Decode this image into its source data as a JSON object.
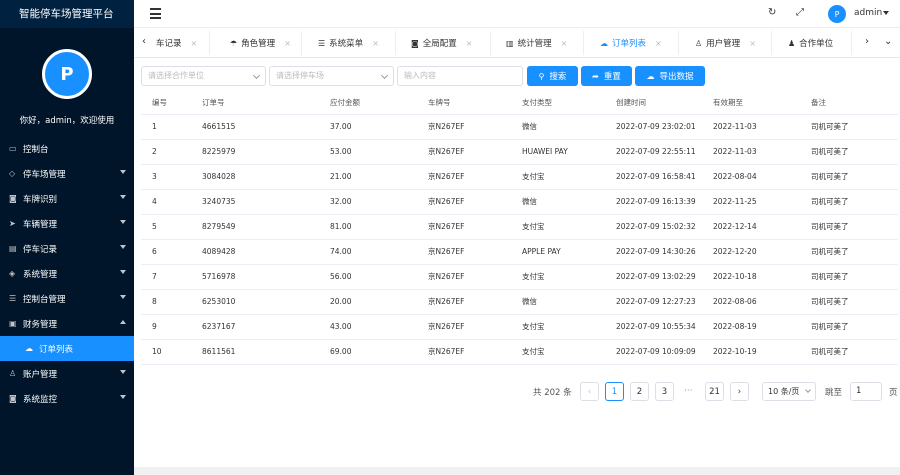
{
  "app": {
    "title": "智能停车场管理平台"
  },
  "user": {
    "welcome": "你好，admin，欢迎使用",
    "name": "admin",
    "avatar_label": "P"
  },
  "sidebar": {
    "items": [
      {
        "label": "控制台",
        "icon": "monitor-icon",
        "glyph": "▭",
        "has_arrow": false
      },
      {
        "label": "停车场管理",
        "icon": "diamond-icon",
        "glyph": "◇",
        "has_arrow": true
      },
      {
        "label": "车牌识别",
        "icon": "camera-icon",
        "glyph": "◙",
        "has_arrow": true
      },
      {
        "label": "车辆管理",
        "icon": "send-icon",
        "glyph": "➤",
        "has_arrow": true
      },
      {
        "label": "停车记录",
        "icon": "document-icon",
        "glyph": "▤",
        "has_arrow": true
      },
      {
        "label": "系统管理",
        "icon": "layers-icon",
        "glyph": "◈",
        "has_arrow": true
      },
      {
        "label": "控制台管理",
        "icon": "list-icon",
        "glyph": "☰",
        "has_arrow": true
      },
      {
        "label": "财务管理",
        "icon": "wallet-icon",
        "glyph": "▣",
        "has_arrow": true,
        "expanded": true
      }
    ],
    "sub_item": {
      "label": "订单列表",
      "icon": "cloud-icon",
      "glyph": "☁"
    },
    "tail_items": [
      {
        "label": "账户管理",
        "icon": "user-icon",
        "glyph": "♙"
      },
      {
        "label": "系统监控",
        "icon": "camera-icon",
        "glyph": "◙"
      }
    ]
  },
  "header": {
    "icons": [
      "menu-icon",
      "refresh-icon",
      "fullscreen-icon"
    ]
  },
  "tabs": [
    {
      "label": "车记录",
      "icon": "",
      "active": false
    },
    {
      "label": "角色管理",
      "icon": "☂",
      "active": false
    },
    {
      "label": "系统菜单",
      "icon": "☰",
      "active": false
    },
    {
      "label": "全局配置",
      "icon": "◙",
      "active": false
    },
    {
      "label": "统计管理",
      "icon": "▥",
      "active": false
    },
    {
      "label": "订单列表",
      "icon": "☁",
      "active": true
    },
    {
      "label": "用户管理",
      "icon": "♙",
      "active": false
    },
    {
      "label": "合作单位",
      "icon": "♟",
      "active": false
    }
  ],
  "filters": {
    "partner_placeholder": "请选择合作单位",
    "lot_placeholder": "请选择停车场",
    "keyword_placeholder": "输入内容",
    "search_label": "搜索",
    "reset_label": "重置",
    "export_label": "导出数据"
  },
  "table": {
    "headers": [
      "编号",
      "订单号",
      "应付金额",
      "车牌号",
      "支付类型",
      "创建时间",
      "有效期至",
      "备注"
    ],
    "rows": [
      [
        "1",
        "4661515",
        "37.00",
        "京N267EF",
        "微信",
        "2022-07-09 23:02:01",
        "2022-11-03",
        "司机可美了"
      ],
      [
        "2",
        "8225979",
        "53.00",
        "京N267EF",
        "HUAWEI PAY",
        "2022-07-09 22:55:11",
        "2022-11-03",
        "司机可美了"
      ],
      [
        "3",
        "3084028",
        "21.00",
        "京N267EF",
        "支付宝",
        "2022-07-09 16:58:41",
        "2022-08-04",
        "司机可美了"
      ],
      [
        "4",
        "3240735",
        "32.00",
        "京N267EF",
        "微信",
        "2022-07-09 16:13:39",
        "2022-11-25",
        "司机可美了"
      ],
      [
        "5",
        "8279549",
        "81.00",
        "京N267EF",
        "支付宝",
        "2022-07-09 15:02:32",
        "2022-12-14",
        "司机可美了"
      ],
      [
        "6",
        "4089428",
        "74.00",
        "京N267EF",
        "APPLE PAY",
        "2022-07-09 14:30:26",
        "2022-12-20",
        "司机可美了"
      ],
      [
        "7",
        "5716978",
        "56.00",
        "京N267EF",
        "支付宝",
        "2022-07-09 13:02:29",
        "2022-10-18",
        "司机可美了"
      ],
      [
        "8",
        "6253010",
        "20.00",
        "京N267EF",
        "微信",
        "2022-07-09 12:27:23",
        "2022-08-06",
        "司机可美了"
      ],
      [
        "9",
        "6237167",
        "43.00",
        "京N267EF",
        "支付宝",
        "2022-07-09 10:55:34",
        "2022-08-19",
        "司机可美了"
      ],
      [
        "10",
        "8611561",
        "69.00",
        "京N267EF",
        "支付宝",
        "2022-07-09 10:09:09",
        "2022-10-19",
        "司机可美了"
      ]
    ]
  },
  "pagination": {
    "total_label": "共 202 条",
    "pages": [
      "1",
      "2",
      "3",
      "21"
    ],
    "current": "1",
    "ellipsis": "···",
    "prev": "‹",
    "next": "›",
    "page_size": "10 条/页",
    "goto_label": "跳至",
    "goto_value": "1",
    "page_suffix": "页"
  },
  "colors": {
    "sidebar_bg": "#001529",
    "accent": "#1890ff"
  }
}
